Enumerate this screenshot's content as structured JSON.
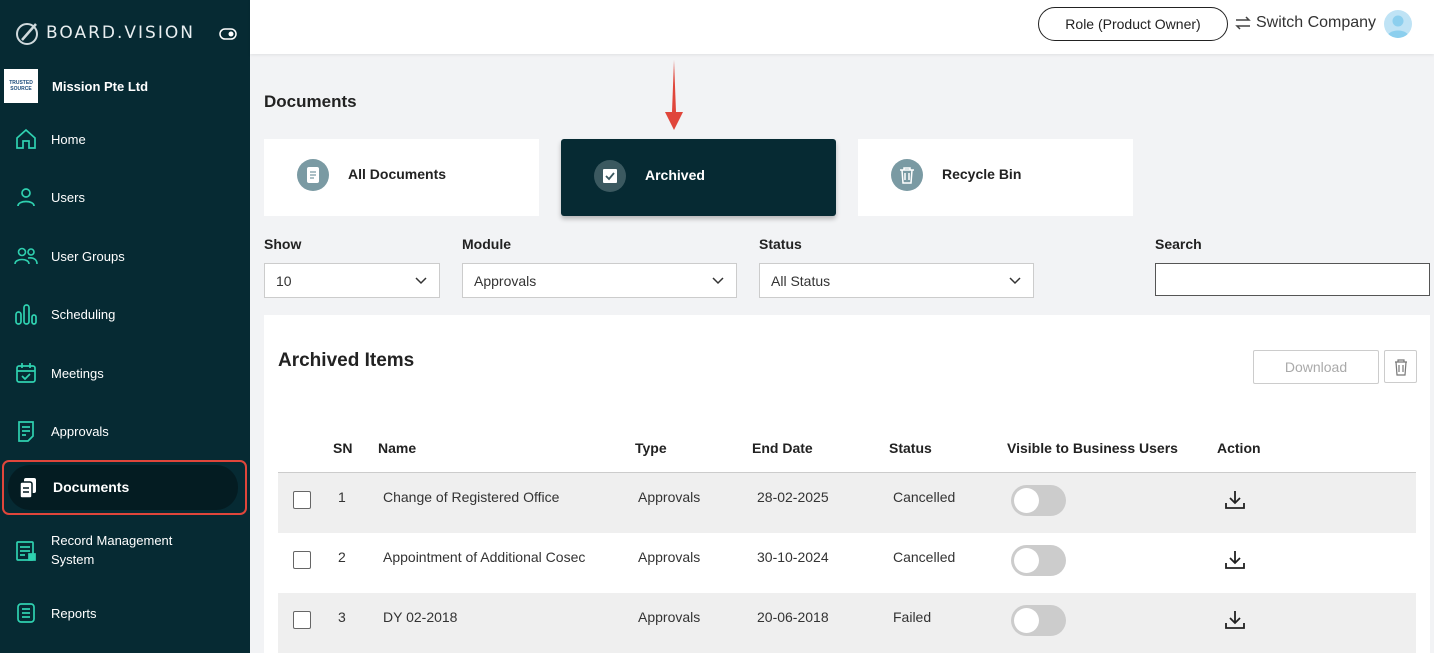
{
  "brand": {
    "name": "BOARD.VISION"
  },
  "company": {
    "name": "Mission Pte Ltd",
    "logo_text_1": "TRUSTED",
    "logo_text_2": "SOURCE"
  },
  "nav": [
    {
      "label": "Home",
      "icon": "home-icon"
    },
    {
      "label": "Users",
      "icon": "user-icon"
    },
    {
      "label": "User Groups",
      "icon": "user-groups-icon"
    },
    {
      "label": "Scheduling",
      "icon": "scheduling-icon"
    },
    {
      "label": "Meetings",
      "icon": "calendar-icon"
    },
    {
      "label": "Approvals",
      "icon": "approvals-icon"
    },
    {
      "label": "Documents",
      "icon": "documents-icon",
      "active": true
    },
    {
      "label": "Record Management System",
      "icon": "record-icon"
    },
    {
      "label": "Reports",
      "icon": "reports-icon"
    }
  ],
  "topbar": {
    "role": "Role (Product Owner)",
    "switch_company": "Switch Company"
  },
  "page": {
    "title": "Documents"
  },
  "tabs": [
    {
      "label": "All Documents",
      "icon": "document-icon"
    },
    {
      "label": "Archived",
      "icon": "checkbox-icon",
      "active": true
    },
    {
      "label": "Recycle Bin",
      "icon": "trash-icon"
    }
  ],
  "filters": {
    "show": {
      "label": "Show",
      "value": "10"
    },
    "module": {
      "label": "Module",
      "value": "Approvals"
    },
    "status": {
      "label": "Status",
      "value": "All Status"
    },
    "search": {
      "label": "Search",
      "value": ""
    }
  },
  "panel": {
    "title": "Archived Items",
    "download": "Download",
    "columns": [
      "SN",
      "Name",
      "Type",
      "End Date",
      "Status",
      "Visible to Business Users",
      "Action"
    ],
    "rows": [
      {
        "sn": "1",
        "name": "Change of Registered Office",
        "type": "Approvals",
        "end_date": "28-02-2025",
        "status": "Cancelled",
        "visible": false
      },
      {
        "sn": "2",
        "name": "Appointment of Additional Cosec",
        "type": "Approvals",
        "end_date": "30-10-2024",
        "status": "Cancelled",
        "visible": false
      },
      {
        "sn": "3",
        "name": "DY 02-2018",
        "type": "Approvals",
        "end_date": "20-06-2018",
        "status": "Failed",
        "visible": false
      }
    ]
  },
  "colors": {
    "sidebar_bg": "#062a33",
    "highlight": "#e0463b",
    "tab_active_bg": "#062a33"
  }
}
